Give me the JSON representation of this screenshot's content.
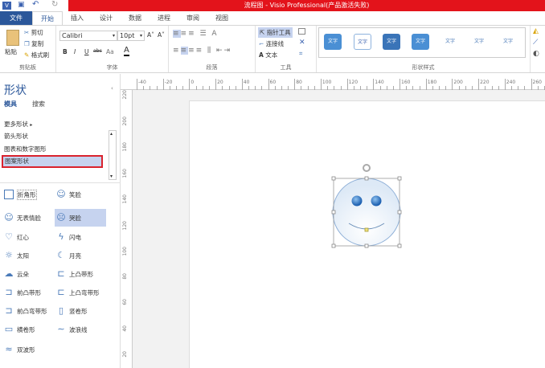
{
  "title": "流程图 - Visio Professional(产品激活失败)",
  "tabs": [
    "文件",
    "开始",
    "插入",
    "设计",
    "数据",
    "进程",
    "审阅",
    "视图"
  ],
  "ribbon": {
    "clipboard": {
      "paste": "粘贴",
      "cut": "剪切",
      "copy": "复制",
      "format_painter": "格式刷",
      "label": "剪贴板"
    },
    "font": {
      "name": "Calibri",
      "size": "10pt",
      "label": "字体",
      "bold": "B",
      "italic": "I",
      "underline": "U",
      "strike": "abc",
      "case": "Aa"
    },
    "paragraph": {
      "label": "段落"
    },
    "tools": {
      "pointer": "指针工具",
      "connector": "连接线",
      "text": "文本",
      "label": "工具"
    },
    "shape_styles": {
      "label": "形状样式",
      "items": [
        "文字",
        "文字",
        "文字",
        "文字",
        "文字",
        "文字",
        "文字"
      ]
    }
  },
  "panel": {
    "title": "形状",
    "tabs": [
      "模具",
      "搜索"
    ],
    "more": "更多形状",
    "stencils": [
      "箭头形状",
      "图表和数字图形",
      "图案形状"
    ],
    "shapes": [
      "折角形",
      "笑脸",
      "无表情脸",
      "哭脸",
      "红心",
      "闪电",
      "太阳",
      "月亮",
      "云朵",
      "上凸带形",
      "前凸带形",
      "上凸弯带形",
      "前凸弯带形",
      "竖卷形",
      "横卷形",
      "波浪线",
      "双波形"
    ]
  },
  "hruler": [
    "-40",
    "-20",
    "0",
    "20",
    "40",
    "60",
    "80",
    "100",
    "120",
    "140",
    "160",
    "180",
    "200",
    "220",
    "240",
    "260"
  ],
  "vruler": [
    "220",
    "200",
    "180",
    "160",
    "140",
    "120",
    "100",
    "80",
    "60",
    "40",
    "20"
  ],
  "colors": {
    "accent": "#2b579a",
    "title_bar": "#e3131b",
    "selection": "#c6d3ef",
    "highlight_border": "#d9232e"
  }
}
